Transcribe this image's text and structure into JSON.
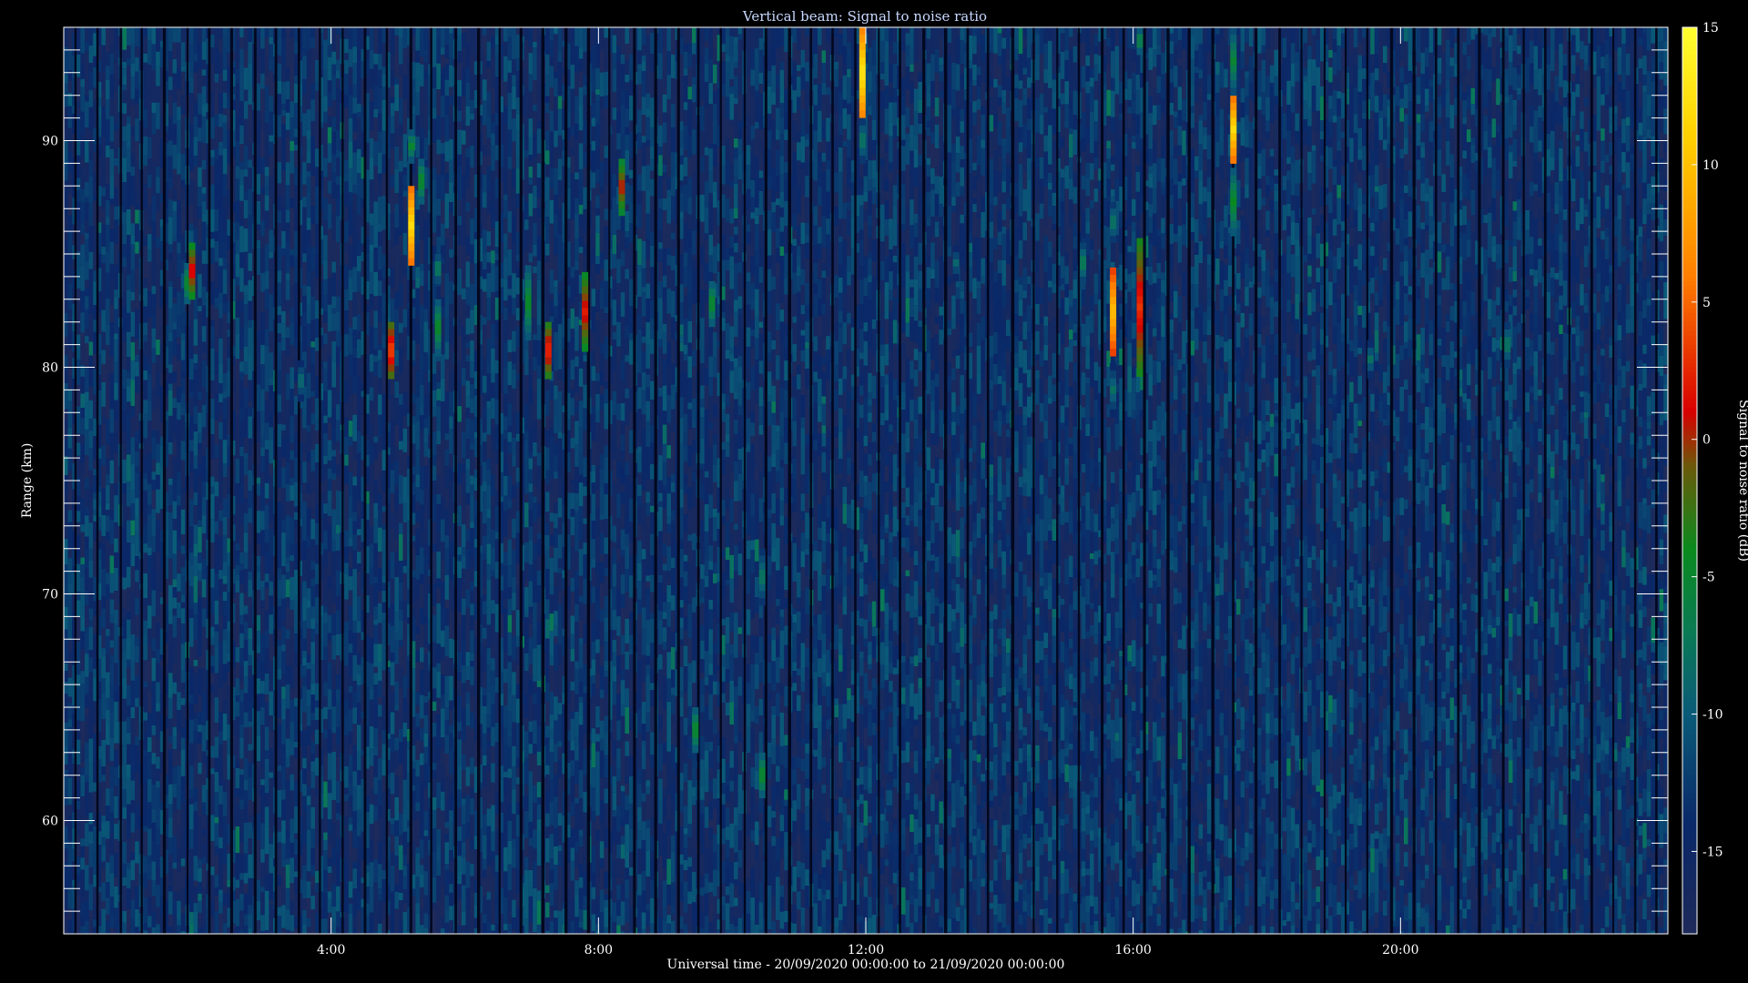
{
  "chart_data": {
    "type": "heatmap",
    "title": "Vertical beam: Signal to noise ratio",
    "xlabel": "Universal time - 20/09/2020 00:00:00 to 21/09/2020 00:00:00",
    "ylabel": "Range (km)",
    "colorbar_label": "Signal to noise ratio (dB)",
    "xlim_hours": [
      0,
      24
    ],
    "ylim_km": [
      55,
      95
    ],
    "clim_db": [
      -18,
      15
    ],
    "x_ticks": [
      {
        "value": 4,
        "label": "4:00"
      },
      {
        "value": 8,
        "label": "8:00"
      },
      {
        "value": 12,
        "label": "12:00"
      },
      {
        "value": 16,
        "label": "16:00"
      },
      {
        "value": 20,
        "label": "20:00"
      }
    ],
    "x_minor_step_hours": 1,
    "y_ticks": [
      {
        "value": 60,
        "label": "60"
      },
      {
        "value": 70,
        "label": "70"
      },
      {
        "value": 80,
        "label": "80"
      },
      {
        "value": 90,
        "label": "90"
      }
    ],
    "y_minor_step_km": 1,
    "colorbar_ticks": [
      {
        "value": 15,
        "label": "15"
      },
      {
        "value": 10,
        "label": "10"
      },
      {
        "value": 5,
        "label": "5"
      },
      {
        "value": 0,
        "label": "0"
      },
      {
        "value": -5,
        "label": "-5"
      },
      {
        "value": -10,
        "label": "-10"
      },
      {
        "value": -15,
        "label": "-15"
      }
    ],
    "colormap": [
      {
        "db": -18,
        "color": "#1e2a5a"
      },
      {
        "db": -14,
        "color": "#0a2868"
      },
      {
        "db": -10,
        "color": "#0a5a78"
      },
      {
        "db": -7,
        "color": "#0a7a55"
      },
      {
        "db": -4,
        "color": "#0a8a1e"
      },
      {
        "db": -1,
        "color": "#6a5a0a"
      },
      {
        "db": 1,
        "color": "#d80000"
      },
      {
        "db": 6,
        "color": "#ff8000"
      },
      {
        "db": 11,
        "color": "#ffd000"
      },
      {
        "db": 15,
        "color": "#ffff30"
      }
    ],
    "background_db": -14,
    "features": [
      {
        "t": 1.85,
        "r0": 82.8,
        "r1": 84.6,
        "db": -4
      },
      {
        "t": 1.92,
        "r0": 83.0,
        "r1": 85.5,
        "db": 2
      },
      {
        "t": 3.55,
        "r0": 78.5,
        "r1": 80.3,
        "db": -8
      },
      {
        "t": 4.9,
        "r0": 79.5,
        "r1": 82.0,
        "db": 4
      },
      {
        "t": 5.2,
        "r0": 84.5,
        "r1": 88.0,
        "db": 12
      },
      {
        "t": 5.2,
        "r0": 89.0,
        "r1": 90.5,
        "db": -5
      },
      {
        "t": 5.35,
        "r0": 87.2,
        "r1": 89.2,
        "db": -4
      },
      {
        "t": 5.6,
        "r0": 80.5,
        "r1": 83.0,
        "db": -4
      },
      {
        "t": 5.6,
        "r0": 83.7,
        "r1": 85.0,
        "db": -6
      },
      {
        "t": 6.95,
        "r0": 81.2,
        "r1": 84.5,
        "db": -4
      },
      {
        "t": 7.25,
        "r0": 79.5,
        "r1": 82.0,
        "db": 3
      },
      {
        "t": 7.8,
        "r0": 80.7,
        "r1": 84.2,
        "db": 2
      },
      {
        "t": 8.35,
        "r0": 86.7,
        "r1": 89.2,
        "db": 1
      },
      {
        "t": 9.45,
        "r0": 63.0,
        "r1": 65.0,
        "db": -4
      },
      {
        "t": 9.7,
        "r0": 81.8,
        "r1": 83.8,
        "db": -4
      },
      {
        "t": 10.45,
        "r0": 61.0,
        "r1": 63.0,
        "db": -4
      },
      {
        "t": 10.45,
        "r0": 69.5,
        "r1": 72.0,
        "db": -7
      },
      {
        "t": 11.95,
        "r0": 91.0,
        "r1": 95.0,
        "db": 13
      },
      {
        "t": 11.95,
        "r0": 89.0,
        "r1": 91.0,
        "db": -7
      },
      {
        "t": 12.35,
        "r0": 60.0,
        "r1": 62.0,
        "db": -10
      },
      {
        "t": 13.35,
        "r0": 83.8,
        "r1": 85.4,
        "db": -9
      },
      {
        "t": 15.25,
        "r0": 83.7,
        "r1": 85.5,
        "db": -6
      },
      {
        "t": 15.7,
        "r0": 80.5,
        "r1": 84.4,
        "db": 10
      },
      {
        "t": 15.7,
        "r0": 77.8,
        "r1": 80.2,
        "db": -8
      },
      {
        "t": 15.7,
        "r0": 85.5,
        "r1": 87.3,
        "db": -7
      },
      {
        "t": 16.1,
        "r0": 79.6,
        "r1": 85.7,
        "db": 3
      },
      {
        "t": 16.1,
        "r0": 93.8,
        "r1": 95.0,
        "db": -5
      },
      {
        "t": 17.5,
        "r0": 89.0,
        "r1": 92.0,
        "db": 12
      },
      {
        "t": 17.5,
        "r0": 85.8,
        "r1": 88.8,
        "db": -4
      },
      {
        "t": 17.5,
        "r0": 92.0,
        "r1": 95.0,
        "db": -5
      },
      {
        "t": 19.55,
        "r0": 79.5,
        "r1": 81.2,
        "db": -8
      },
      {
        "t": 21.6,
        "r0": 80.0,
        "r1": 82.0,
        "db": -7
      }
    ]
  }
}
